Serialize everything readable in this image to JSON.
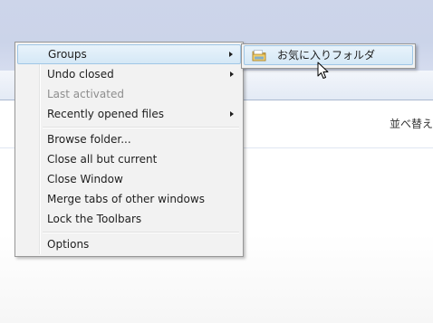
{
  "menu": {
    "items": [
      {
        "label": "Groups",
        "submenu": true,
        "hot": true
      },
      {
        "label": "Undo closed",
        "submenu": true
      },
      {
        "label": "Last activated",
        "disabled": true
      },
      {
        "label": "Recently opened files",
        "submenu": true
      },
      {
        "label": "Browse folder..."
      },
      {
        "label": "Close all but current"
      },
      {
        "label": "Close Window"
      },
      {
        "label": "Merge tabs of other windows"
      },
      {
        "label": "Lock the Toolbars"
      },
      {
        "label": "Options"
      }
    ]
  },
  "submenu": {
    "items": [
      {
        "label": "お気に入りフォルダ",
        "icon": "folder-icon"
      }
    ]
  },
  "explorer": {
    "sort_label": "並べ替え"
  }
}
